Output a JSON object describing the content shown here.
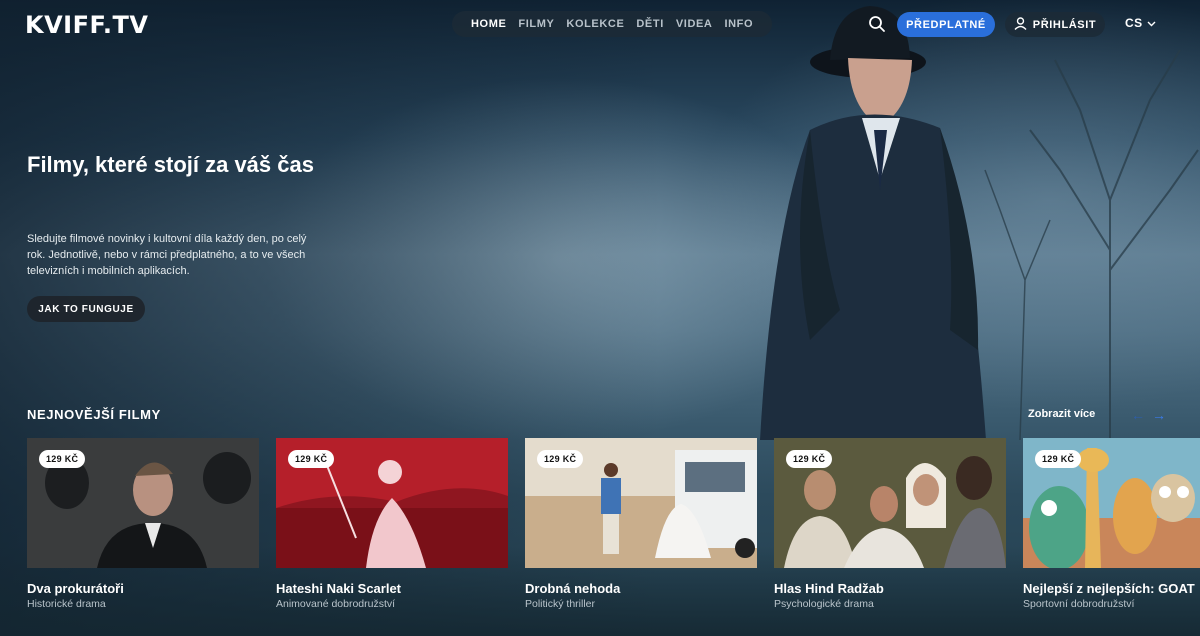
{
  "header": {
    "logo": "KVIFF.TV",
    "nav": [
      "HOME",
      "FILMY",
      "KOLEKCE",
      "DĚTI",
      "VIDEA",
      "INFO"
    ],
    "active_nav": "HOME",
    "subscribe_label": "PŘEDPLATNÉ",
    "login_label": "PŘIHLÁSIT",
    "language": "CS",
    "icons": [
      "search-icon",
      "user-icon",
      "chevron-down-icon"
    ]
  },
  "hero": {
    "title": "Filmy, které stojí za váš čas",
    "text": "Sledujte filmové novinky i kultovní díla každý den, po celý rok. Jednotlivě, nebo v rámci předplatného, a to ve všech televizních i mobilních aplikacích.",
    "button_label": "JAK TO FUNGUJE"
  },
  "newest": {
    "title": "NEJNOVĚJŠÍ FILMY",
    "show_more": "Zobrazit více",
    "prev_icon": "←",
    "next_icon": "→",
    "films": [
      {
        "price": "129 KČ",
        "title": "Dva prokurátoři",
        "genre": "Historické drama"
      },
      {
        "price": "129 KČ",
        "title": "Hateshi Naki Scarlet",
        "genre": "Animované dobrodružství"
      },
      {
        "price": "129 KČ",
        "title": "Drobná nehoda",
        "genre": "Politický thriller"
      },
      {
        "price": "129 KČ",
        "title": "Hlas Hind Radžab",
        "genre": "Psychologické drama"
      },
      {
        "price": "129 KČ",
        "title": "Nejlepší z nejlepších: GOAT",
        "genre": "Sportovní dobrodružství"
      }
    ]
  },
  "colors": {
    "accent": "#2a6fdb",
    "background": "#1f3a4d"
  }
}
